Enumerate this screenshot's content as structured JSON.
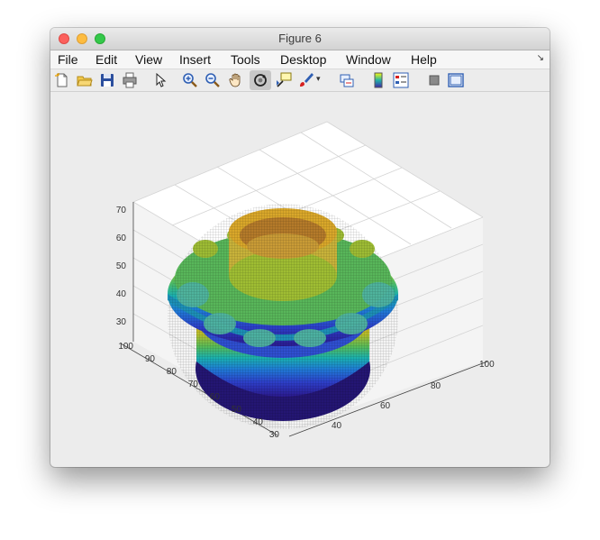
{
  "window": {
    "title": "Figure 6"
  },
  "menu": {
    "items": [
      {
        "id": "file",
        "label": "File"
      },
      {
        "id": "edit",
        "label": "Edit"
      },
      {
        "id": "view",
        "label": "View"
      },
      {
        "id": "insert",
        "label": "Insert"
      },
      {
        "id": "tools",
        "label": "Tools"
      },
      {
        "id": "desktop",
        "label": "Desktop"
      },
      {
        "id": "window",
        "label": "Window"
      },
      {
        "id": "help",
        "label": "Help"
      }
    ]
  },
  "toolbar": {
    "buttons": [
      "new-figure-icon",
      "open-file-icon",
      "save-icon",
      "print-icon",
      "pointer-icon",
      "zoom-in-icon",
      "zoom-out-icon",
      "pan-hand-icon",
      "rotate-3d-icon",
      "data-cursor-icon",
      "brush-icon",
      "dropdown-arrow-icon",
      "link-plot-icon",
      "colorbar-icon",
      "legend-icon",
      "hide-plot-tools-icon",
      "show-plot-tools-icon"
    ],
    "active": "rotate-3d-icon"
  },
  "chart_data": {
    "type": "surface-3d",
    "title": "",
    "colormap": "parula",
    "grid": true,
    "z_axis": {
      "ticks": [
        "30",
        "40",
        "50",
        "60",
        "70"
      ],
      "range": [
        25,
        75
      ]
    },
    "y_axis": {
      "ticks": [
        "100",
        "90",
        "80",
        "70",
        "60",
        "50",
        "40",
        "30"
      ],
      "range": [
        25,
        105
      ]
    },
    "x_axis": {
      "ticks": [
        "40",
        "60",
        "80",
        "100"
      ],
      "range": [
        25,
        105
      ]
    }
  }
}
